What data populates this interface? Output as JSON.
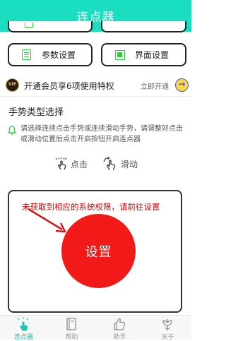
{
  "header": {
    "title": "连点器",
    "background": "#19dfc0"
  },
  "buttons": {
    "params_label": "参数设置",
    "ui_label": "界面设置"
  },
  "vip": {
    "badge": "VIP",
    "text": "开通会员享6项使用特权",
    "link": "立即开通"
  },
  "gesture": {
    "section_title": "手势类型选择",
    "hint": "请选择连续点击手势或连续滑动手势，请调整好点击或滑动位置后点击开启按钮开启连点器",
    "options": [
      {
        "label": "点击",
        "icon": "tap-icon"
      },
      {
        "label": "滑动",
        "icon": "swipe-icon"
      }
    ]
  },
  "panel": {
    "warning": "未获取到相应的系统权限，请前往设置",
    "action_label": "设置",
    "action_color": "#f21919"
  },
  "bottom_nav": {
    "items": [
      {
        "label": "连点器",
        "icon": "tap-icon",
        "active": true
      },
      {
        "label": "帮助",
        "icon": "book-icon",
        "active": false
      },
      {
        "label": "助手",
        "icon": "thumbs-up-icon",
        "active": false
      },
      {
        "label": "关于",
        "icon": "flower-icon",
        "active": false
      }
    ]
  }
}
